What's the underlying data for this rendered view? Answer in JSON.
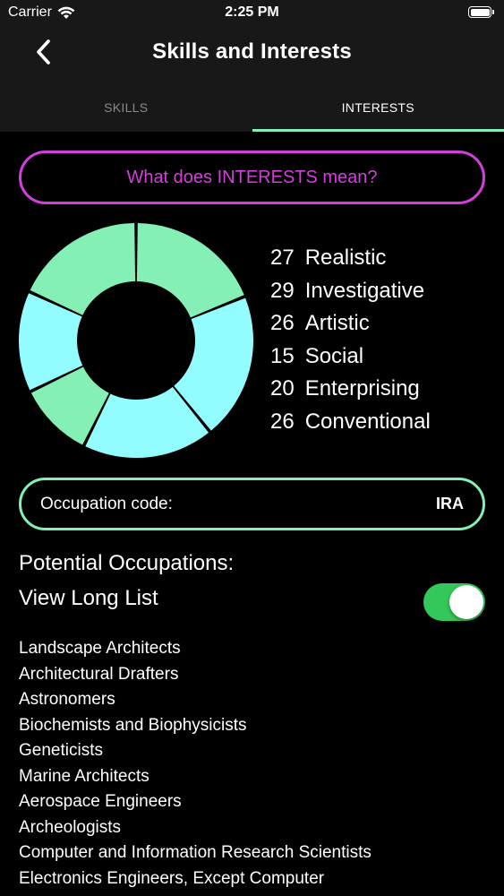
{
  "status_bar": {
    "carrier": "Carrier",
    "time": "2:25 PM",
    "icons": [
      "wifi-icon",
      "battery-icon"
    ]
  },
  "nav": {
    "title": "Skills and Interests",
    "back_icon": "chevron-left-icon"
  },
  "tabs": [
    {
      "label": "SKILLS",
      "active": false
    },
    {
      "label": "INTERESTS",
      "active": true
    }
  ],
  "meaning_button": {
    "label": "What does INTERESTS mean?"
  },
  "interests": [
    {
      "value": "27",
      "label": "Realistic"
    },
    {
      "value": "29",
      "label": "Investigative"
    },
    {
      "value": "26",
      "label": "Artistic"
    },
    {
      "value": "15",
      "label": "Social"
    },
    {
      "value": "20",
      "label": "Enterprising"
    },
    {
      "value": "26",
      "label": "Conventional"
    }
  ],
  "donut_colors": [
    "#84f0b5",
    "#93fcff",
    "#93fcff",
    "#84f0b5",
    "#93fcff",
    "#84f0b5"
  ],
  "occupation_code": {
    "label": "Occupation code:",
    "value": "IRA"
  },
  "potential_heading": "Potential Occupations:",
  "long_list": {
    "label": "View Long List",
    "enabled": true
  },
  "occupations": [
    "Landscape Architects",
    "Architectural Drafters",
    "Astronomers",
    "Biochemists and Biophysicists",
    "Geneticists",
    "Marine Architects",
    "Aerospace Engineers",
    "Archeologists",
    "Computer and Information Research Scientists",
    "Electronics Engineers, Except Computer"
  ],
  "colors": {
    "accent_green": "#84f0b5",
    "accent_cyan": "#93fcff",
    "accent_magenta": "#d33fdc",
    "toggle_on": "#34c759",
    "bar_background": "#181818"
  }
}
